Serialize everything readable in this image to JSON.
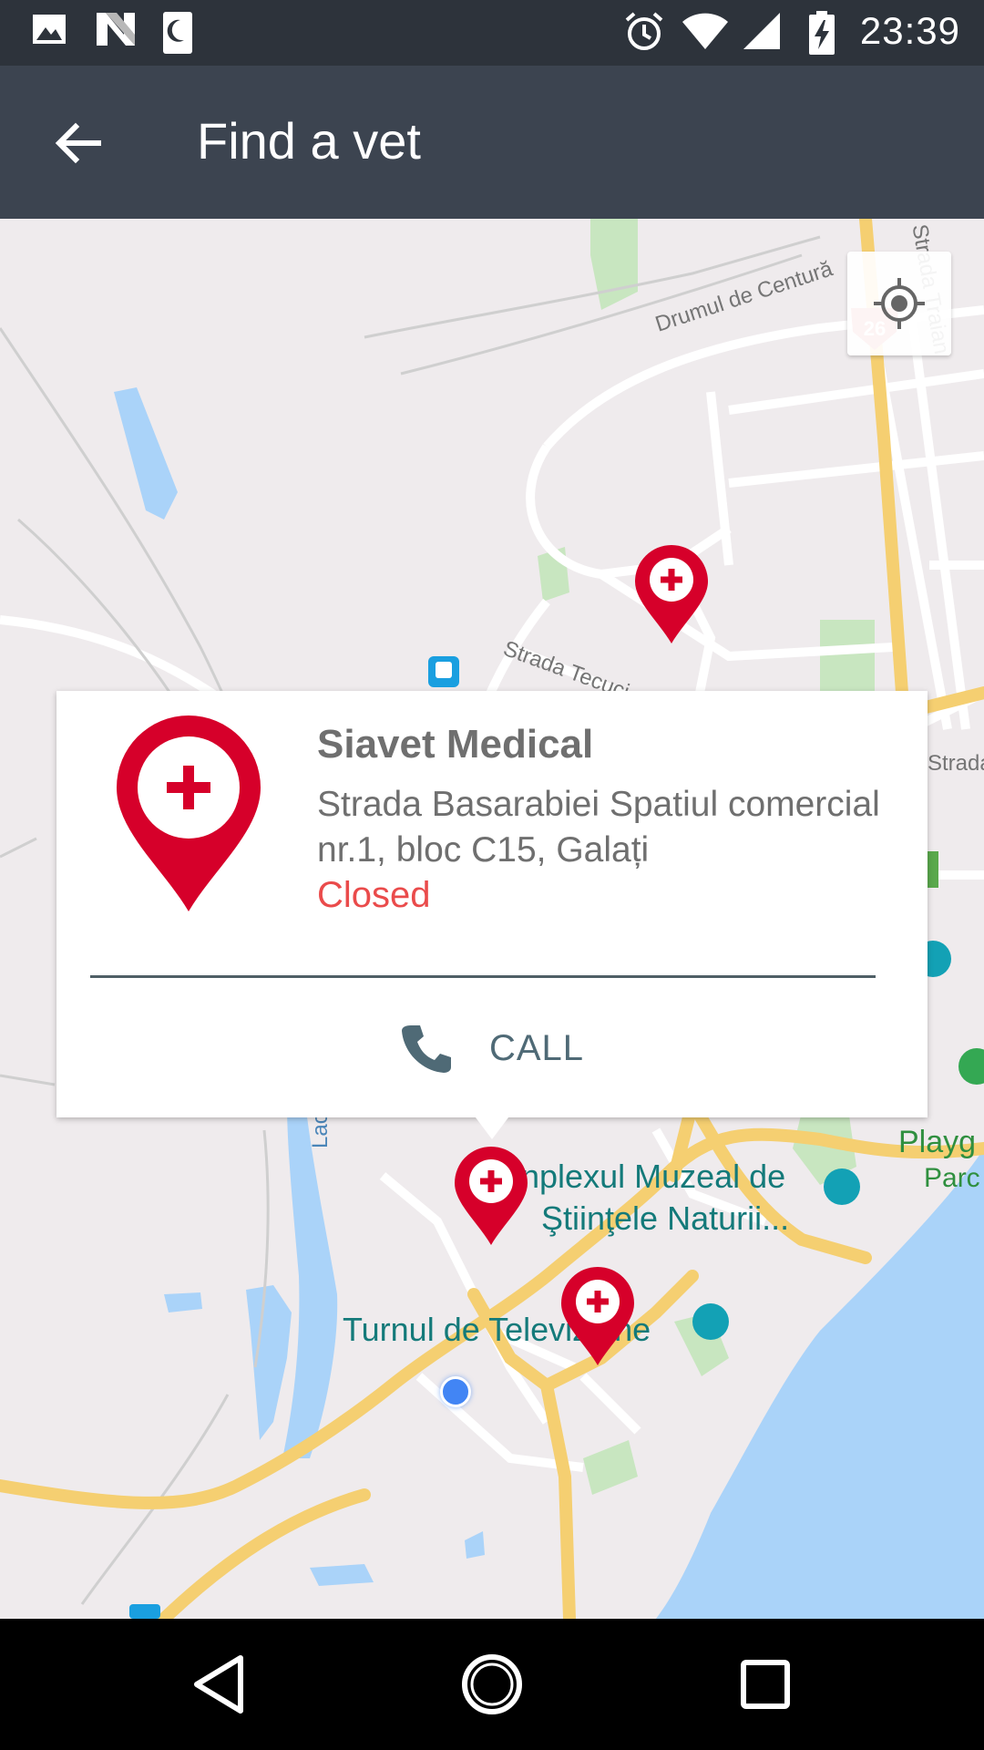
{
  "status_bar": {
    "time": "23:39",
    "left_icons": [
      "image-icon",
      "n-logo-icon",
      "moon-icon"
    ],
    "right_icons": [
      "alarm-icon",
      "wifi-icon",
      "signal-icon",
      "battery-charging-icon"
    ]
  },
  "app_bar": {
    "title": "Find a vet",
    "back_icon": "arrow-back-icon"
  },
  "map": {
    "labels": {
      "drumul": "Drumul de Centură",
      "tecuci": "Strada Tecuci",
      "traian": "Strada Traian",
      "strada_m": "Strada M",
      "lacul": "Lacul",
      "route": "26"
    },
    "pois": {
      "muzeu_line1": "nplexul Muzeal de",
      "muzeu_line2": "Ştiinţele Naturii...",
      "turnul": "Turnul de Televiziune",
      "playg": "Playg",
      "parc": "Parc"
    },
    "locate_icon": "my-location-icon"
  },
  "info_card": {
    "name": "Siavet Medical",
    "address": "Strada Basarabiei Spatiul comercial nr.1, bloc C15, Galați",
    "status": "Closed",
    "call_label": "CALL",
    "call_icon": "phone-icon",
    "status_color": "#ea4b4b"
  },
  "nav_bar": {
    "icons": [
      "nav-back-icon",
      "nav-home-icon",
      "nav-recents-icon"
    ]
  },
  "colors": {
    "app_bar": "#3c4450",
    "status_bar": "#2d333b",
    "marker_red": "#d6002a",
    "water": "#aad3f9",
    "road_yellow": "#f8d67e"
  }
}
